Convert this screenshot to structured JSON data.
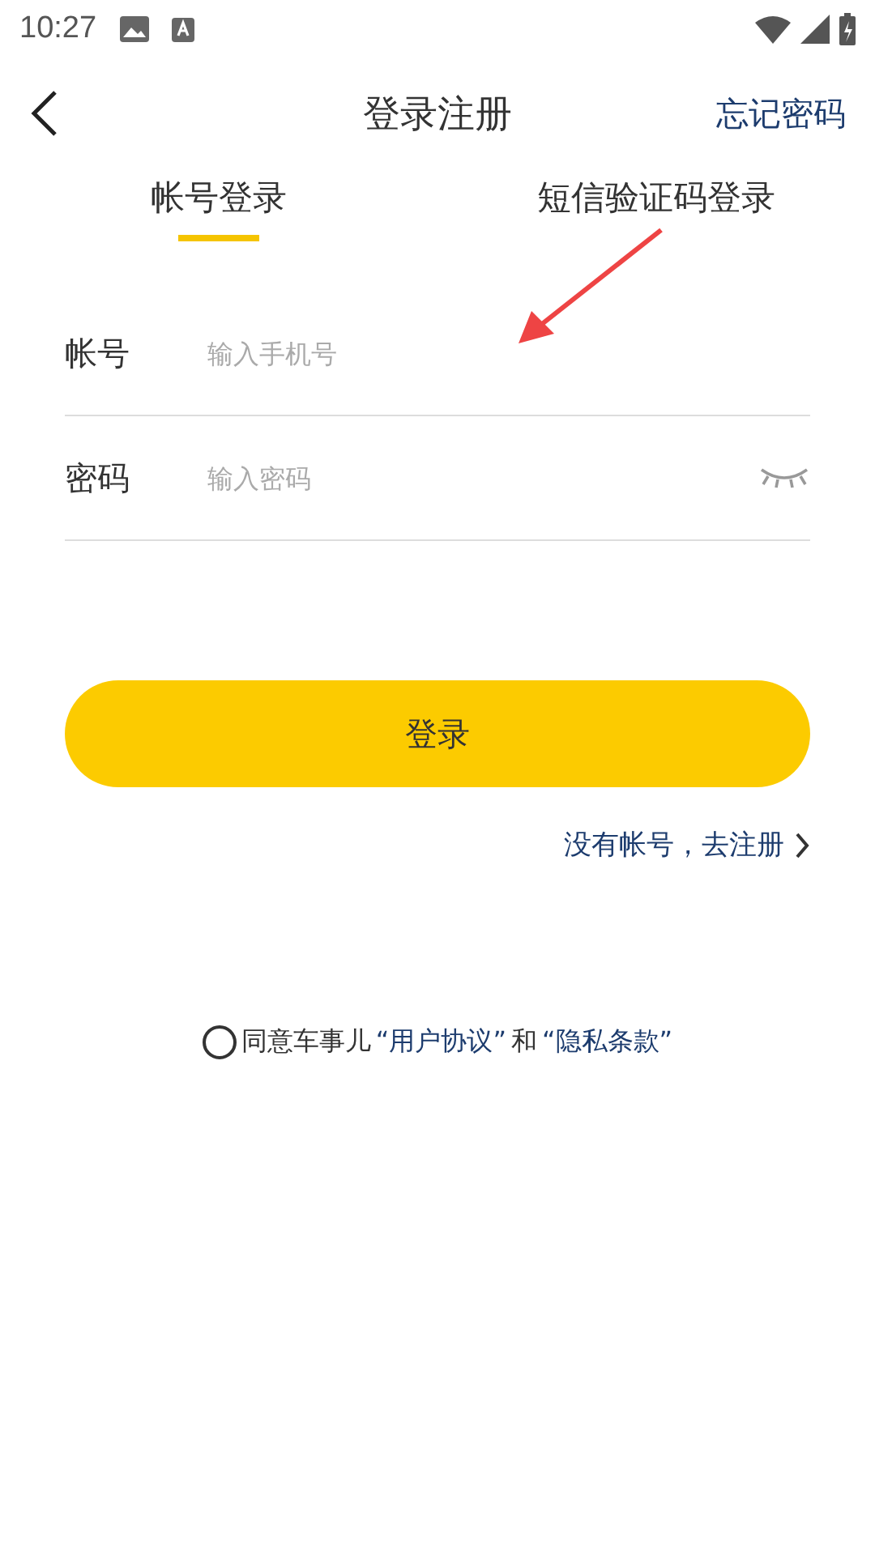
{
  "status_bar": {
    "time": "10:27"
  },
  "header": {
    "title": "登录注册",
    "action": "忘记密码"
  },
  "tabs": [
    {
      "label": "帐号登录",
      "selected": true
    },
    {
      "label": "短信验证码登录",
      "selected": false
    }
  ],
  "fields": [
    {
      "kind": "text",
      "label": "帐号",
      "placeholder": "输入手机号"
    },
    {
      "kind": "password",
      "label": "密码",
      "placeholder": "输入密码"
    }
  ],
  "login_button": "登录",
  "register_link": "没有帐号，去注册",
  "agreement": {
    "checked": false,
    "text": "同意车事儿",
    "link_1": "“用户协议”",
    "joiner": "和",
    "link_2": "“隐私条款”"
  }
}
